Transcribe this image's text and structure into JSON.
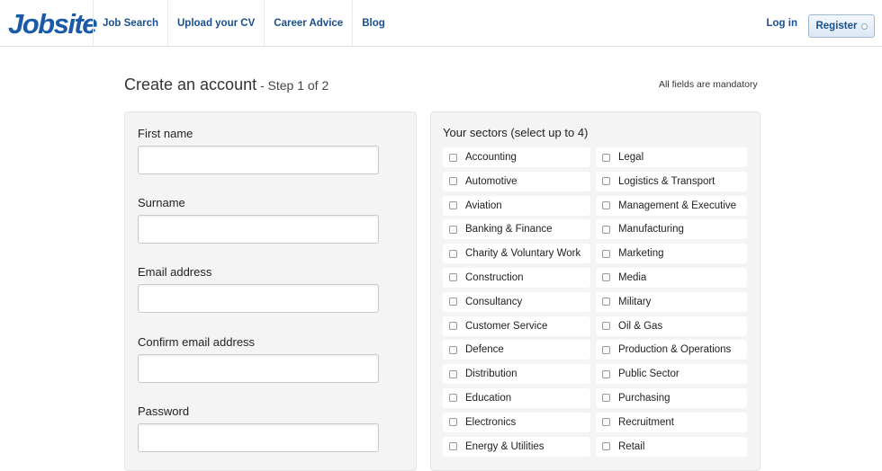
{
  "header": {
    "logo": "Jobsite",
    "nav": [
      "Job Search",
      "Upload your CV",
      "Career Advice",
      "Blog"
    ],
    "login": "Log in",
    "register": "Register"
  },
  "page": {
    "title": "Create an account",
    "step": " - Step 1 of 2",
    "mandatory": "All fields are mandatory"
  },
  "form": {
    "first_name": {
      "label": "First name",
      "value": ""
    },
    "surname": {
      "label": "Surname",
      "value": ""
    },
    "email": {
      "label": "Email address",
      "value": ""
    },
    "confirm_email": {
      "label": "Confirm email address",
      "value": ""
    },
    "password": {
      "label": "Password",
      "value": ""
    }
  },
  "sectors": {
    "title": "Your sectors (select up to 4)",
    "left": [
      "Accounting",
      "Automotive",
      "Aviation",
      "Banking & Finance",
      "Charity & Voluntary Work",
      "Construction",
      "Consultancy",
      "Customer Service",
      "Defence",
      "Distribution",
      "Education",
      "Electronics",
      "Energy & Utilities"
    ],
    "right": [
      "Legal",
      "Logistics & Transport",
      "Management & Executive",
      "Manufacturing",
      "Marketing",
      "Media",
      "Military",
      "Oil & Gas",
      "Production & Operations",
      "Public Sector",
      "Purchasing",
      "Recruitment",
      "Retail"
    ]
  }
}
